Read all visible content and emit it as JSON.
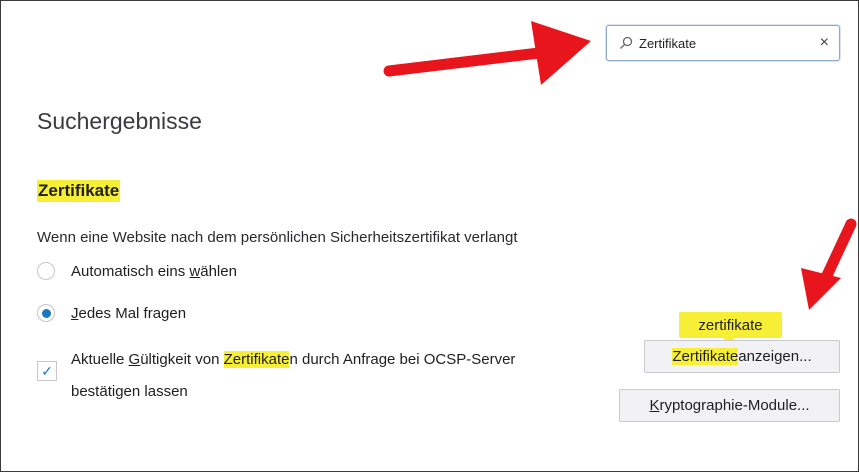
{
  "search": {
    "value": "Zertifikate",
    "clear_icon": "×"
  },
  "page": {
    "title": "Suchergebnisse"
  },
  "section": {
    "title": "Zertifikate",
    "description": "Wenn eine Website nach dem persönlichen Sicherheitszertifikat verlangt",
    "options": [
      {
        "pre": "Automatisch eins ",
        "key": "w",
        "post": "ählen",
        "selected": false
      },
      {
        "pre": "",
        "key": "J",
        "post": "edes Mal fragen",
        "selected": true
      }
    ],
    "ocsp": {
      "checked": true,
      "line1_a": "Aktuelle ",
      "line1_key": "G",
      "line1_b": "ültigkeit von ",
      "line1_hl": "Zertifikate",
      "line1_c": "n durch Anfrage bei OCSP-Server",
      "line2": "bestätigen lassen"
    }
  },
  "tooltip": {
    "text": "zertifikate"
  },
  "buttons": {
    "view_certs_hl": "Zertifikate",
    "view_certs_rest": " anzeigen...",
    "crypto_key": "K",
    "crypto_rest": "ryptographie-Module..."
  },
  "colors": {
    "highlight": "#f7ef35",
    "accent": "#1a78c2",
    "arrow": "#e8161c"
  }
}
